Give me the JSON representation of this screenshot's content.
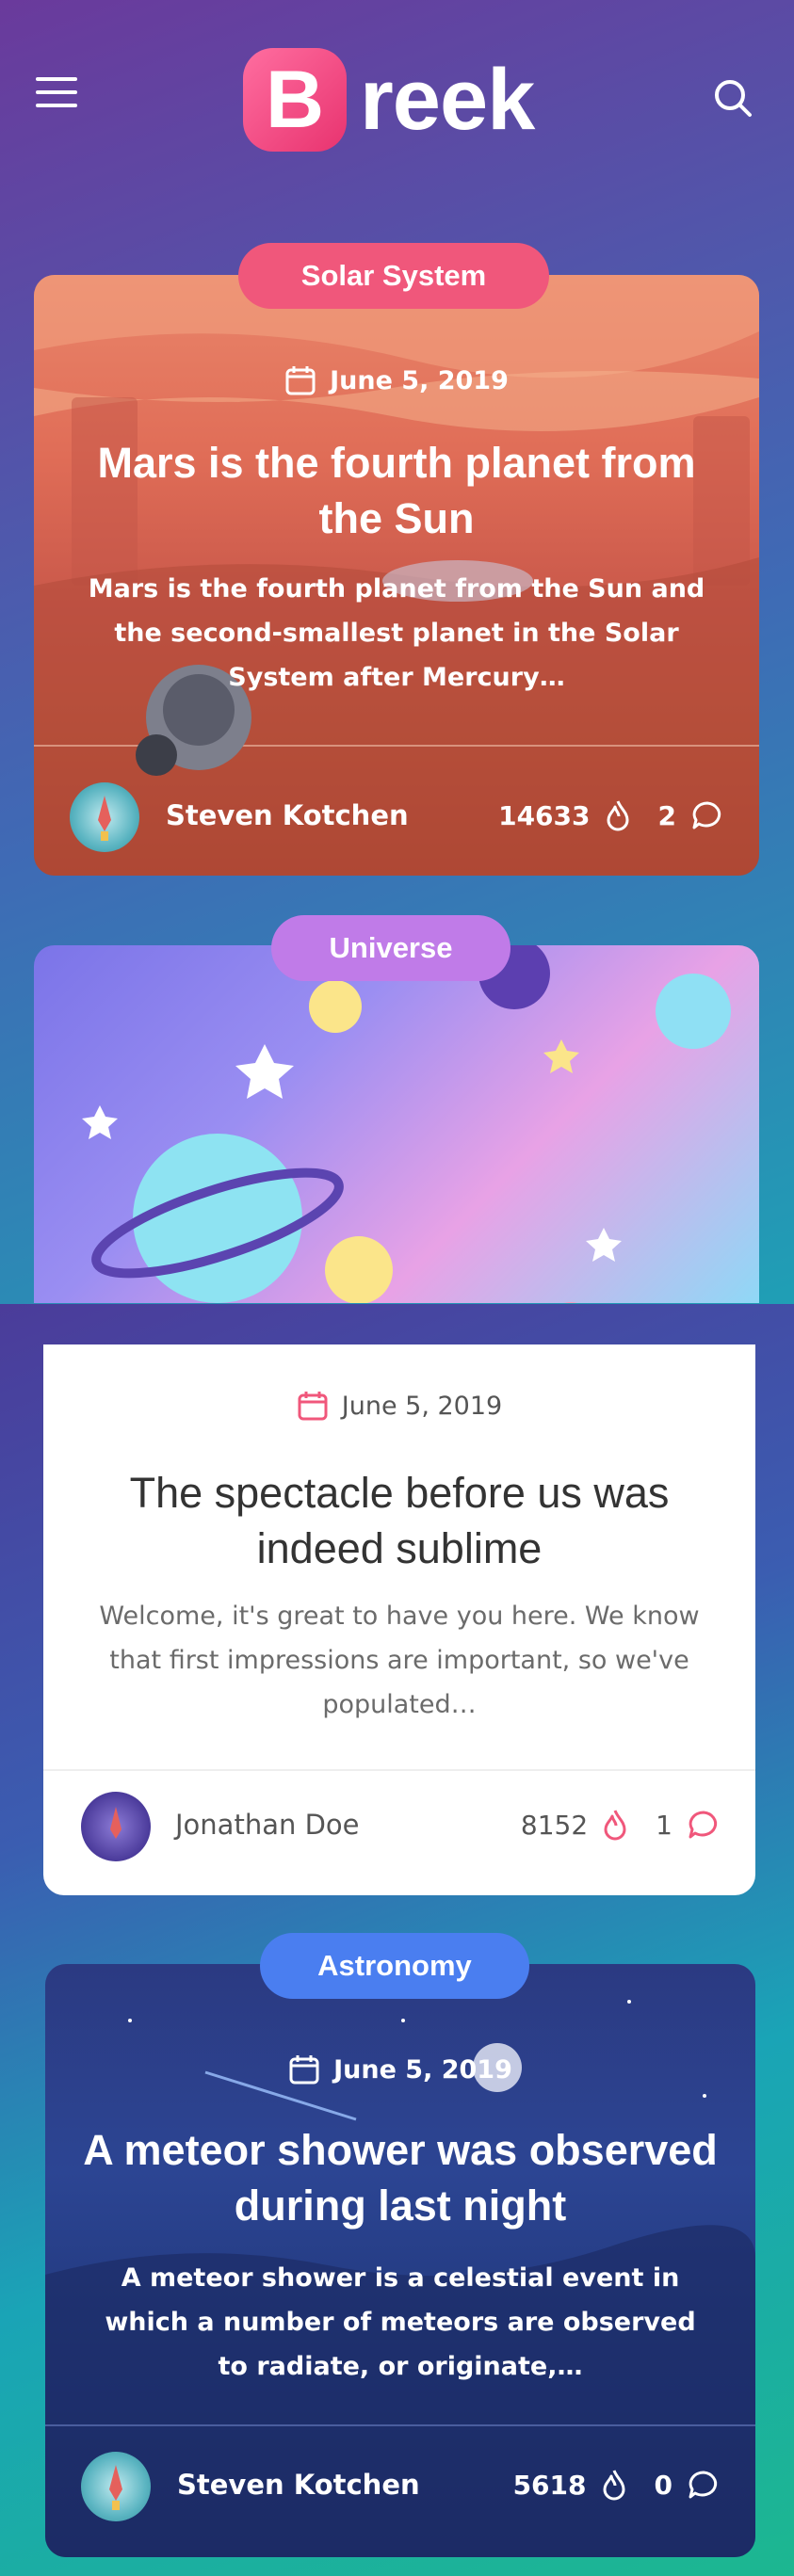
{
  "header": {
    "logo_letter": "B",
    "logo_text": "reek"
  },
  "posts": [
    {
      "category": "Solar System",
      "category_color": "#f0577b",
      "date": "June 5, 2019",
      "title": "Mars is the fourth planet from the Sun",
      "excerpt": "Mars is the fourth planet from the Sun and the second-smallest planet in the Solar System after Mercury…",
      "author": "Steven Kotchen",
      "likes": "14633",
      "comments": "2"
    },
    {
      "category": "Universe",
      "category_color": "#c07be8",
      "date": "June 5, 2019",
      "title": "The spectacle before us was indeed sublime",
      "excerpt": "Welcome, it's great to have you here. We know that first impressions are important, so we've populated…",
      "author": "Jonathan Doe",
      "likes": "8152",
      "comments": "1"
    },
    {
      "category": "Astronomy",
      "category_color": "#4a7ef0",
      "date": "June 5, 2019",
      "title": "A meteor shower was observed during last night",
      "excerpt": "A meteor shower is a celestial event in which a number of meteors are observed to radiate, or originate,…",
      "author": "Steven Kotchen",
      "likes": "5618",
      "comments": "0"
    }
  ],
  "icons": {
    "menu": "hamburger-icon",
    "search": "search-icon",
    "date": "calendar-icon",
    "likes": "flame-icon",
    "comments": "comment-icon"
  },
  "colors": {
    "accent_pink": "#f0577b",
    "text_dark": "#333333",
    "text_muted": "#6b6b6b"
  }
}
